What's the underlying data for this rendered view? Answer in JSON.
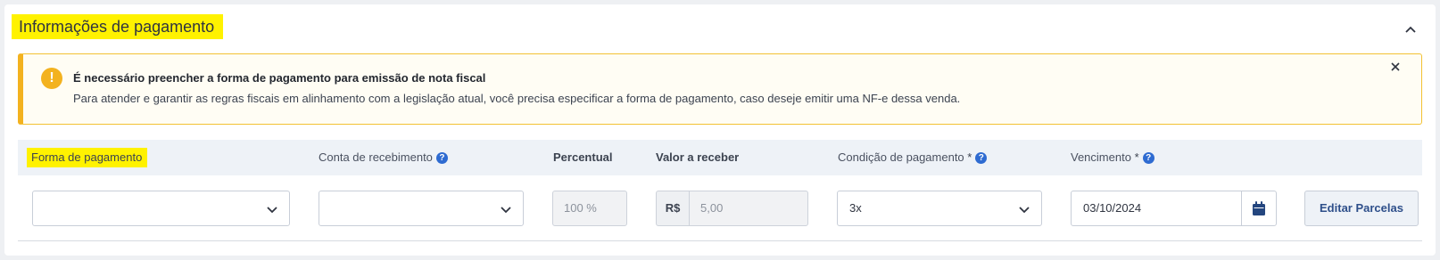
{
  "section": {
    "title": "Informações de pagamento",
    "collapse_icon": "chevron-up-icon"
  },
  "alert": {
    "icon": "exclamation-icon",
    "icon_glyph": "!",
    "title": "É necessário preencher a forma de pagamento para emissão de nota fiscal",
    "message": "Para atender e garantir as regras fiscais em alinhamento com a legislação atual, você precisa especificar a forma de pagamento, caso deseje emitir uma NF-e dessa venda.",
    "close_icon": "close-icon",
    "accent_color": "#f3b21f"
  },
  "columns": {
    "forma": "Forma de pagamento",
    "conta": "Conta de recebimento",
    "percentual": "Percentual",
    "valor": "Valor a receber",
    "condicao": "Condição de pagamento",
    "vencimento": "Vencimento",
    "required_mark": "*",
    "help_glyph": "?"
  },
  "fields": {
    "forma_value": "",
    "conta_value": "",
    "percentual_value": "100 %",
    "currency_prefix": "R$",
    "valor_value": "5,00",
    "condicao_value": "3x",
    "vencimento_value": "03/10/2024"
  },
  "actions": {
    "edit_installments": "Editar Parcelas"
  },
  "colors": {
    "highlight": "#fff200",
    "help_icon": "#2e6bd1",
    "calendar_icon": "#24467f"
  }
}
